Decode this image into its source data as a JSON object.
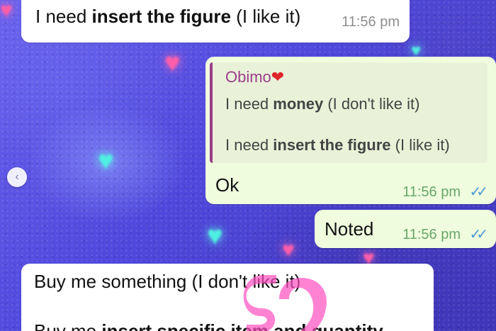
{
  "messages": [
    {
      "type": "incoming",
      "text_plain": "I need ",
      "text_bold": "insert the figure",
      "text_tail": " (I like it)",
      "time": "11:56 pm"
    },
    {
      "type": "outgoing",
      "quote": {
        "author": "Obimo",
        "author_emoji": "❤",
        "line1_plain": "I need ",
        "line1_bold": "money",
        "line1_tail": " (I don't like it)",
        "line2_plain": "I need ",
        "line2_bold": "insert the figure",
        "line2_tail": " (I like it)"
      },
      "text": "Ok",
      "time": "11:56 pm",
      "status_icon": "double-check-icon"
    },
    {
      "type": "outgoing",
      "text": "Noted",
      "time": "11:56 pm",
      "status_icon": "double-check-icon"
    },
    {
      "type": "incoming",
      "line1": "Buy me something (I don't like it)",
      "line2_plain": "Buy me ",
      "line2_bold": "insert specific item and quantity"
    }
  ],
  "icons": {
    "nav": "chevron-left-icon",
    "check": "✓✓"
  },
  "colors": {
    "outgoing_bubble": "#effdde",
    "incoming_bubble": "#ffffff",
    "quote_accent": "#9b3d8a",
    "read_check": "#4a9ad8",
    "wallpaper": "#5b55e6"
  }
}
